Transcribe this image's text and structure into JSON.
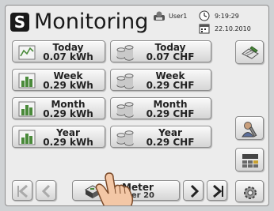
{
  "header": {
    "logo_letter": "S",
    "title": "Monitoring",
    "user": "User1",
    "time": "9:19:29",
    "date": "22.10.2010"
  },
  "tiles": [
    {
      "label": "Today",
      "energy": "0.07 kWh",
      "cost": "0.07 CHF"
    },
    {
      "label": "Week",
      "energy": "0.29 kWh",
      "cost": "0.29 CHF"
    },
    {
      "label": "Month",
      "energy": "0.29 kWh",
      "cost": "0.29 CHF"
    },
    {
      "label": "Year",
      "energy": "0.29 kWh",
      "cost": "0.29 CHF"
    }
  ],
  "meter": {
    "label": "Meter",
    "sub_label": "nter 20"
  },
  "icons": {
    "energy": "line-chart-icon",
    "cost": "coins-icon",
    "bar_chart": "bar-chart-icon",
    "export": "export-pen-icon",
    "user_settings": "user-settings-icon",
    "grid": "grid-layout-icon",
    "settings": "settings-gear-icon",
    "first": "first-page-icon",
    "prev": "previous-icon",
    "next": "next-icon",
    "last": "last-page-icon"
  },
  "colors": {
    "background": "#ececec",
    "button_top": "#fafafa",
    "button_bottom": "#d5d5d5",
    "text": "#222222",
    "accent_green": "#4a8a3a"
  }
}
